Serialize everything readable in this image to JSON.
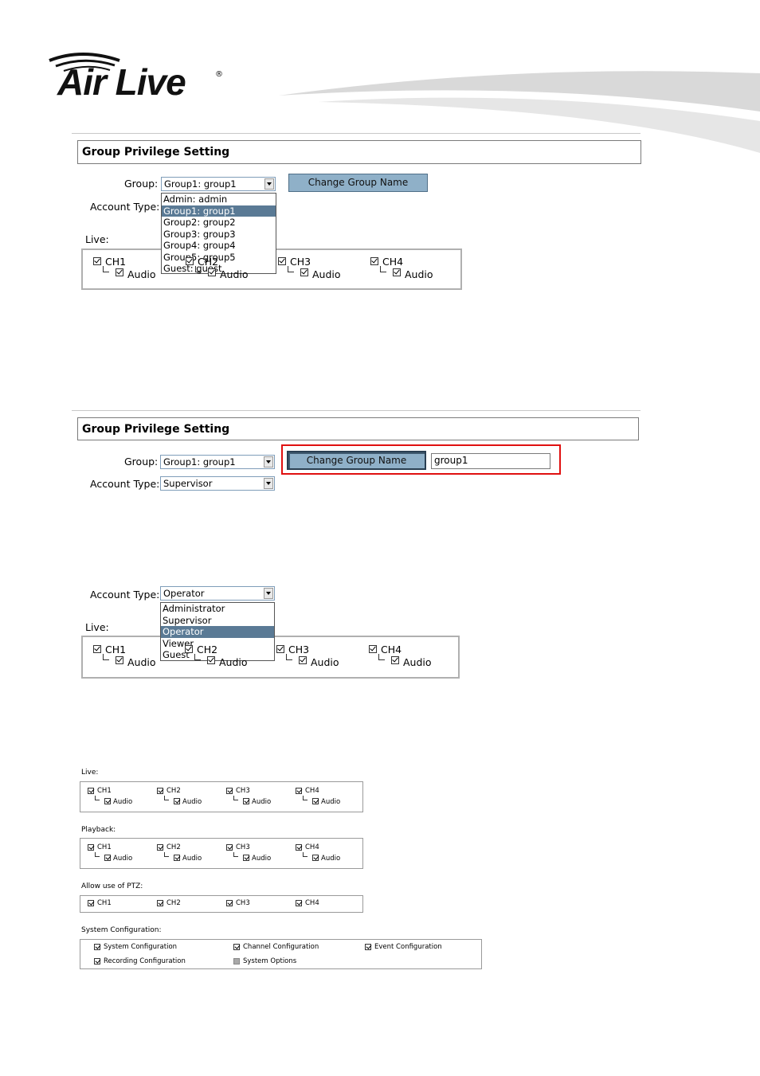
{
  "brand": {
    "logo_text": "Air Live",
    "registered": "®"
  },
  "panel1": {
    "title": "Group Privilege Setting",
    "group_label": "Group:",
    "group_value": "Group1: group1",
    "account_type_label": "Account Type:",
    "change_button": "Change Group Name",
    "group_options": [
      "Admin: admin",
      "Group1: group1",
      "Group2: group2",
      "Group3: group3",
      "Group4: group4",
      "Group5: group5",
      "Guest: guest"
    ],
    "selected_option_index": 1,
    "live_label": "Live:",
    "channels": [
      "CH1",
      "CH2",
      "CH3",
      "CH4"
    ],
    "audio_label": "Audio"
  },
  "panel2": {
    "title": "Group Privilege Setting",
    "group_label": "Group:",
    "group_value": "Group1: group1",
    "account_type_label": "Account Type:",
    "account_type_value": "Supervisor",
    "change_button": "Change Group Name",
    "name_input_value": "group1"
  },
  "panel3": {
    "account_type_label": "Account Type:",
    "account_type_value": "Operator",
    "type_options": [
      "Administrator",
      "Supervisor",
      "Operator",
      "Viewer",
      "Guest"
    ],
    "selected_option_index": 2,
    "live_label": "Live:",
    "channels": [
      "CH1",
      "CH2",
      "CH3",
      "CH4"
    ],
    "audio_label": "Audio"
  },
  "panel4": {
    "live_label": "Live:",
    "playback_label": "Playback:",
    "ptz_label": "Allow use of PTZ:",
    "sysconf_label": "System Configuration:",
    "channels": [
      "CH1",
      "CH2",
      "CH3",
      "CH4"
    ],
    "audio_label": "Audio",
    "sysconf_items": [
      {
        "label": "System Configuration",
        "checked": true
      },
      {
        "label": "Channel Configuration",
        "checked": true
      },
      {
        "label": "Event Configuration",
        "checked": true
      },
      {
        "label": "Recording Configuration",
        "checked": true
      },
      {
        "label": "System Options",
        "checked": false
      }
    ]
  }
}
